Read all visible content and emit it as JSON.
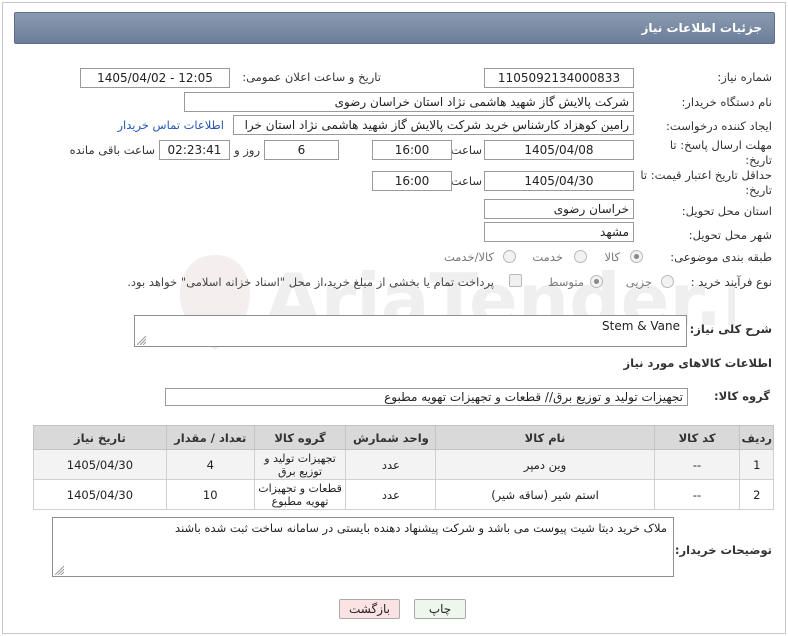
{
  "header": {
    "title": "جزئیات اطلاعات نیاز"
  },
  "fields": {
    "need_number_label": "شماره نیاز:",
    "need_number": "1105092134000833",
    "announce_label": "تاریخ و ساعت اعلان عمومی:",
    "announce_value": "1405/04/02 - 12:05",
    "buyer_org_label": "نام دستگاه خریدار:",
    "buyer_org": "شرکت پالایش گاز شهید هاشمی نژاد   استان خراسان رضوی",
    "creator_label": "ایجاد کننده درخواست:",
    "creator": "رامین کوهزاد کارشناس خرید شرکت پالایش گاز شهید هاشمی نژاد   استان خرا",
    "contact_link": "اطلاعات تماس خریدار",
    "reply_deadline_label": "مهلت ارسال پاسخ: تا تاریخ:",
    "reply_date": "1405/04/08",
    "hour_label": "ساعت",
    "reply_time": "16:00",
    "days_value": "6",
    "day_and_label": "روز و",
    "remaining_time": "02:23:41",
    "remaining_label": "ساعت باقی مانده",
    "price_valid_label": "حداقل تاریخ اعتبار قیمت: تا تاریخ:",
    "price_date": "1405/04/30",
    "price_time": "16:00",
    "province_label": "استان محل تحویل:",
    "province": "خراسان رضوی",
    "city_label": "شهر محل تحویل:",
    "city": "مشهد",
    "category_label": "طبقه بندی موضوعی:",
    "category_options": [
      "کالا",
      "خدمت",
      "کالا/خدمت"
    ],
    "process_label": "نوع فرآیند خرید :",
    "process_options": [
      "جزیی",
      "متوسط"
    ],
    "payment_note": "پرداخت تمام یا بخشی از مبلغ خرید،از محل \"اسناد خزانه اسلامی\" خواهد بود."
  },
  "description": {
    "label": "شرح کلی نیاز:",
    "value": "Stem & Vane"
  },
  "goods_section": {
    "title": "اطلاعات کالاهای مورد نیاز",
    "group_label": "گروه کالا:",
    "group_value": "تجهیزات تولید و توزیع برق// قطعات و تجهیزات تهویه مطبوع"
  },
  "table": {
    "headers": [
      "ردیف",
      "کد کالا",
      "نام کالا",
      "واحد شمارش",
      "گروه کالا",
      "تعداد / مقدار",
      "تاریخ نیاز"
    ],
    "rows": [
      [
        "1",
        "--",
        "وین دمپر",
        "عدد",
        "تجهیزات تولید و توزیع برق",
        "4",
        "1405/04/30"
      ],
      [
        "2",
        "--",
        "استم شیر (ساقه شیر)",
        "عدد",
        "قطعات و تجهیزات تهویه مطبوع",
        "10",
        "1405/04/30"
      ]
    ]
  },
  "buyer_notes": {
    "label": "توضیحات خریدار:",
    "value": "ملاک خرید دیتا شیت پیوست می باشد و شرکت پیشنهاد دهنده بایستی در سامانه ساخت ثبت شده باشند"
  },
  "buttons": {
    "print": "چاپ",
    "back": "بازگشت"
  },
  "watermark": {
    "text": "AriaTender.neT"
  }
}
